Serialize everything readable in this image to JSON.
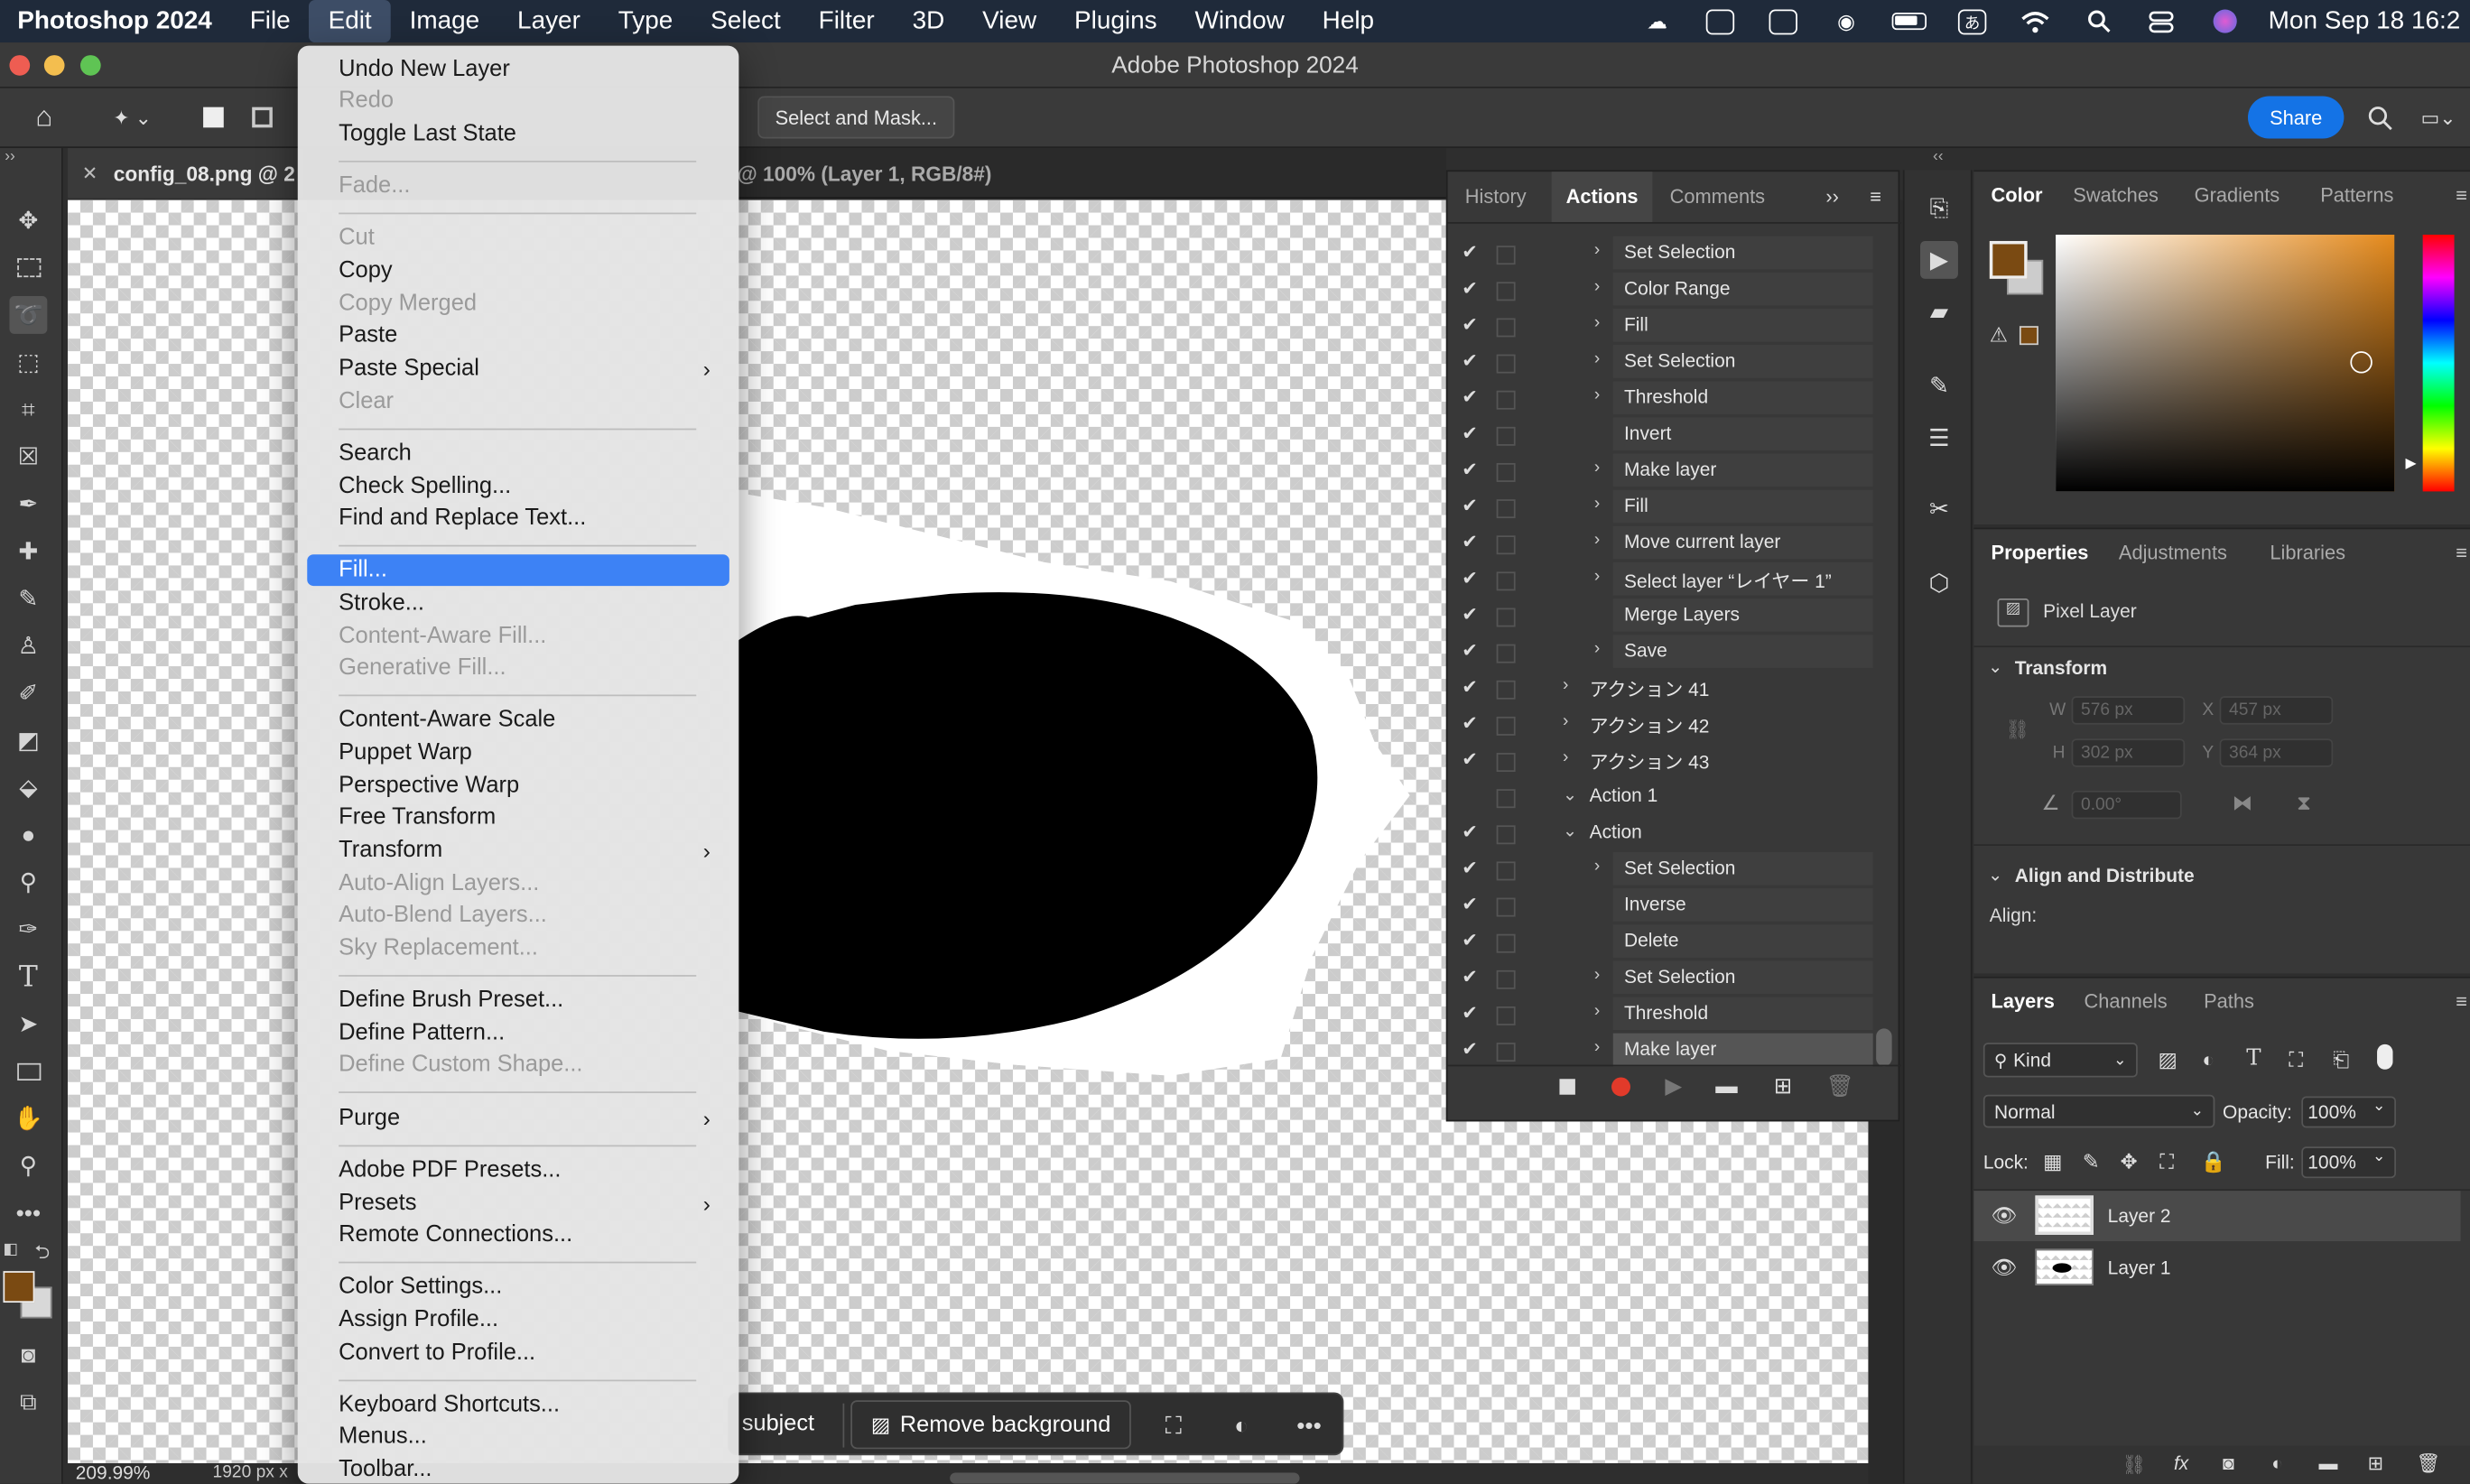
{
  "menubar": {
    "app_name": "Photoshop 2024",
    "items": [
      "File",
      "Edit",
      "Image",
      "Layer",
      "Type",
      "Select",
      "Filter",
      "3D",
      "View",
      "Plugins",
      "Window",
      "Help"
    ],
    "clock": "Mon Sep 18  16:2"
  },
  "window": {
    "title": "Adobe Photoshop 2024"
  },
  "options": {
    "select_mask_label": "Select and Mask...",
    "share_label": "Share"
  },
  "doc": {
    "tab1": "config_08.png @ 2",
    "tab2": "@ 100% (Layer 1, RGB/8#)",
    "zoom": "209.99%",
    "size": "1920 px x"
  },
  "edit_menu": {
    "items": [
      {
        "label": "Undo New Layer",
        "enabled": true
      },
      {
        "label": "Redo",
        "enabled": false
      },
      {
        "label": "Toggle Last State",
        "enabled": true
      },
      {
        "label": "Fade...",
        "enabled": false
      },
      {
        "label": "Cut",
        "enabled": false
      },
      {
        "label": "Copy",
        "enabled": true
      },
      {
        "label": "Copy Merged",
        "enabled": false
      },
      {
        "label": "Paste",
        "enabled": true
      },
      {
        "label": "Paste Special",
        "enabled": true,
        "submenu": true
      },
      {
        "label": "Clear",
        "enabled": false
      },
      {
        "label": "Search",
        "enabled": true
      },
      {
        "label": "Check Spelling...",
        "enabled": true
      },
      {
        "label": "Find and Replace Text...",
        "enabled": true
      },
      {
        "label": "Fill...",
        "enabled": true,
        "highlighted": true
      },
      {
        "label": "Stroke...",
        "enabled": true
      },
      {
        "label": "Content-Aware Fill...",
        "enabled": false
      },
      {
        "label": "Generative Fill...",
        "enabled": false
      },
      {
        "label": "Content-Aware Scale",
        "enabled": true
      },
      {
        "label": "Puppet Warp",
        "enabled": true
      },
      {
        "label": "Perspective Warp",
        "enabled": true
      },
      {
        "label": "Free Transform",
        "enabled": true
      },
      {
        "label": "Transform",
        "enabled": true,
        "submenu": true
      },
      {
        "label": "Auto-Align Layers...",
        "enabled": false
      },
      {
        "label": "Auto-Blend Layers...",
        "enabled": false
      },
      {
        "label": "Sky Replacement...",
        "enabled": false
      },
      {
        "label": "Define Brush Preset...",
        "enabled": true
      },
      {
        "label": "Define Pattern...",
        "enabled": true
      },
      {
        "label": "Define Custom Shape...",
        "enabled": false
      },
      {
        "label": "Purge",
        "enabled": true,
        "submenu": true
      },
      {
        "label": "Adobe PDF Presets...",
        "enabled": true
      },
      {
        "label": "Presets",
        "enabled": true,
        "submenu": true
      },
      {
        "label": "Remote Connections...",
        "enabled": true
      },
      {
        "label": "Color Settings...",
        "enabled": true
      },
      {
        "label": "Assign Profile...",
        "enabled": true
      },
      {
        "label": "Convert to Profile...",
        "enabled": true
      },
      {
        "label": "Keyboard Shortcuts...",
        "enabled": true
      },
      {
        "label": "Menus...",
        "enabled": true
      },
      {
        "label": "Toolbar...",
        "enabled": true
      }
    ],
    "submenu_glyph": "›"
  },
  "actions_panel": {
    "tabs": [
      "History",
      "Actions",
      "Comments"
    ],
    "rows": [
      {
        "label": "Set Selection",
        "expandable": true,
        "checked": true
      },
      {
        "label": "Color Range",
        "expandable": true,
        "checked": true
      },
      {
        "label": "Fill",
        "expandable": true,
        "checked": true
      },
      {
        "label": "Set Selection",
        "expandable": true,
        "checked": true
      },
      {
        "label": "Threshold",
        "expandable": true,
        "checked": true
      },
      {
        "label": "Invert",
        "expandable": false,
        "checked": true
      },
      {
        "label": "Make layer",
        "expandable": true,
        "checked": true
      },
      {
        "label": "Fill",
        "expandable": true,
        "checked": true
      },
      {
        "label": "Move current layer",
        "expandable": true,
        "checked": true
      },
      {
        "label": "Select layer “レイヤー 1”",
        "expandable": true,
        "checked": true
      },
      {
        "label": "Merge Layers",
        "expandable": false,
        "checked": true
      },
      {
        "label": "Save",
        "expandable": true,
        "checked": true
      },
      {
        "label": "アクション 41",
        "expandable": true,
        "checked": true
      },
      {
        "label": "アクション 42",
        "expandable": true,
        "checked": true
      },
      {
        "label": "アクション 43",
        "expandable": true,
        "checked": true
      },
      {
        "label": "Action 1",
        "expandable": true,
        "checked": false
      },
      {
        "label": "Action",
        "expandable": true,
        "checked": true
      },
      {
        "label": "Set Selection",
        "expandable": true,
        "checked": true
      },
      {
        "label": "Inverse",
        "expandable": false,
        "checked": true
      },
      {
        "label": "Delete",
        "expandable": false,
        "checked": true
      },
      {
        "label": "Set Selection",
        "expandable": true,
        "checked": true
      },
      {
        "label": "Threshold",
        "expandable": true,
        "checked": true
      },
      {
        "label": "Make layer",
        "expandable": true,
        "checked": true,
        "selected": true
      }
    ]
  },
  "color_panel": {
    "tabs": [
      "Color",
      "Swatches",
      "Gradients",
      "Patterns"
    ],
    "foreground": "#7a4a12",
    "hue_color": "#e58a1c"
  },
  "properties_panel": {
    "tabs": [
      "Properties",
      "Adjustments",
      "Libraries"
    ],
    "kind": "Pixel Layer",
    "transform_title": "Transform",
    "w_label": "W",
    "w": "576 px",
    "x_label": "X",
    "x": "457 px",
    "h_label": "H",
    "h": "302 px",
    "y_label": "Y",
    "y": "364 px",
    "angle": "0.00°",
    "align_title": "Align and Distribute",
    "align_label": "Align:"
  },
  "layers_panel": {
    "tabs": [
      "Layers",
      "Channels",
      "Paths"
    ],
    "kind_label": "Kind",
    "blend": "Normal",
    "opacity_label": "Opacity:",
    "opacity": "100%",
    "lock_label": "Lock:",
    "fill_label": "Fill:",
    "fill": "100%",
    "layers": [
      {
        "name": "Layer 2",
        "selected": true
      },
      {
        "name": "Layer 1",
        "selected": false
      }
    ]
  },
  "context_bar": {
    "subject_label": "subject",
    "remove_bg_label": "Remove background"
  }
}
